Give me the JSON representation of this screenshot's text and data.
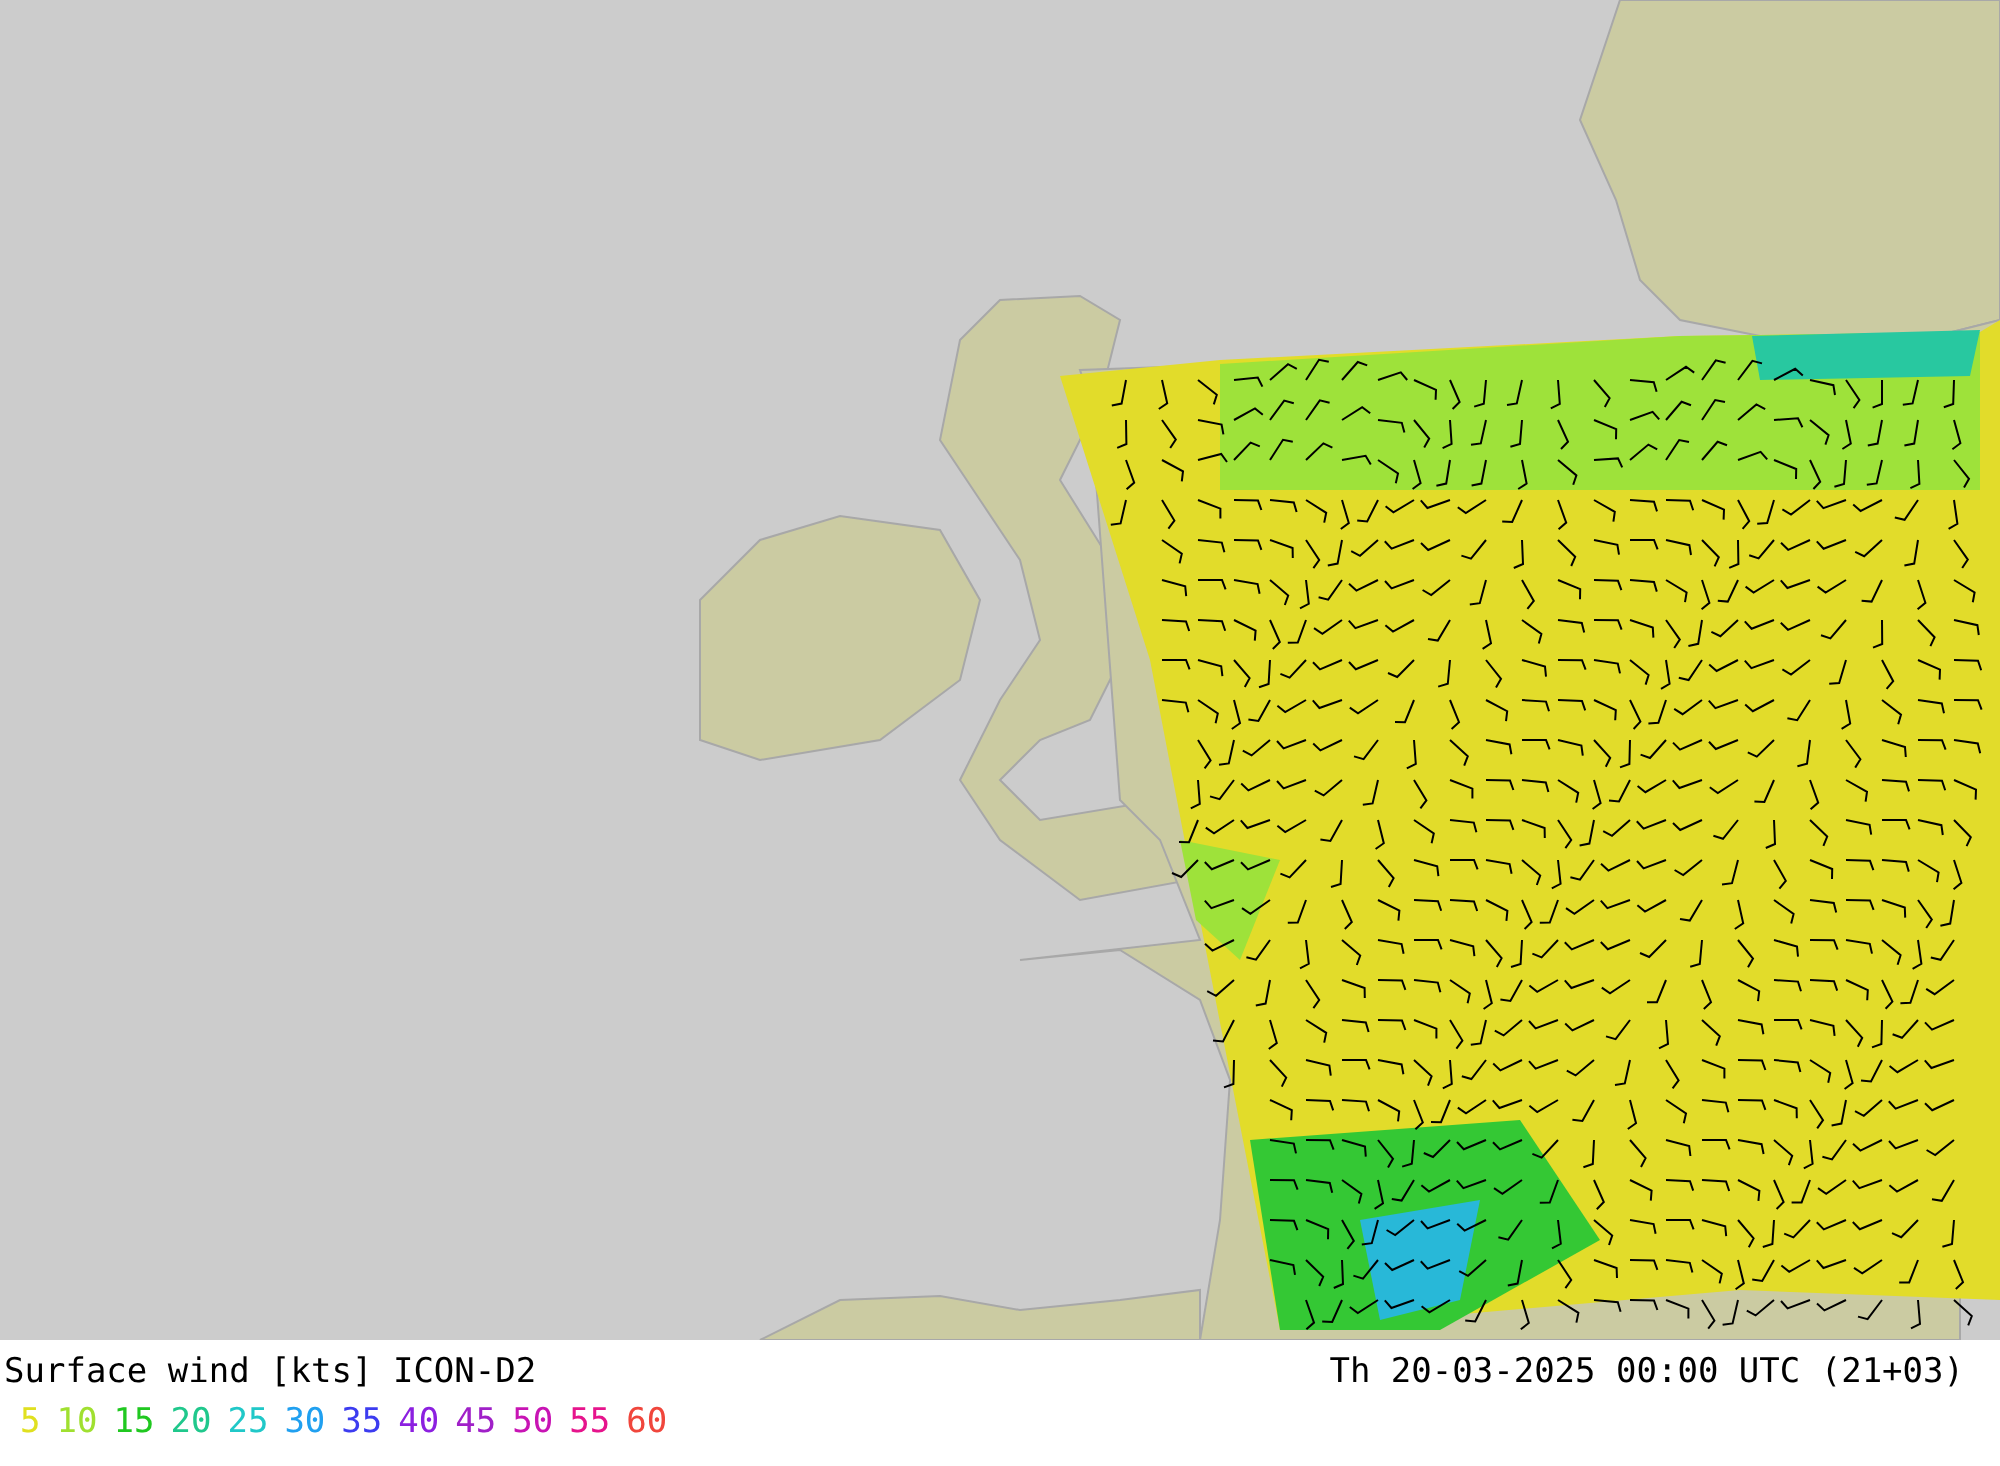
{
  "map": {
    "title": "Surface wind [kts] ICON-D2",
    "valid_time": "Th 20-03-2025 00:00 UTC (21+03)"
  },
  "legend": [
    {
      "label": "5",
      "color": "#e0e020"
    },
    {
      "label": "10",
      "color": "#a0e030"
    },
    {
      "label": "15",
      "color": "#20c820"
    },
    {
      "label": "20",
      "color": "#20c88c"
    },
    {
      "label": "25",
      "color": "#20c8c8"
    },
    {
      "label": "30",
      "color": "#20a0f0"
    },
    {
      "label": "35",
      "color": "#3c3cf0"
    },
    {
      "label": "40",
      "color": "#8c20e0"
    },
    {
      "label": "45",
      "color": "#a020c8"
    },
    {
      "label": "50",
      "color": "#c814b4"
    },
    {
      "label": "55",
      "color": "#e6148c"
    },
    {
      "label": "60",
      "color": "#f0463c"
    }
  ]
}
